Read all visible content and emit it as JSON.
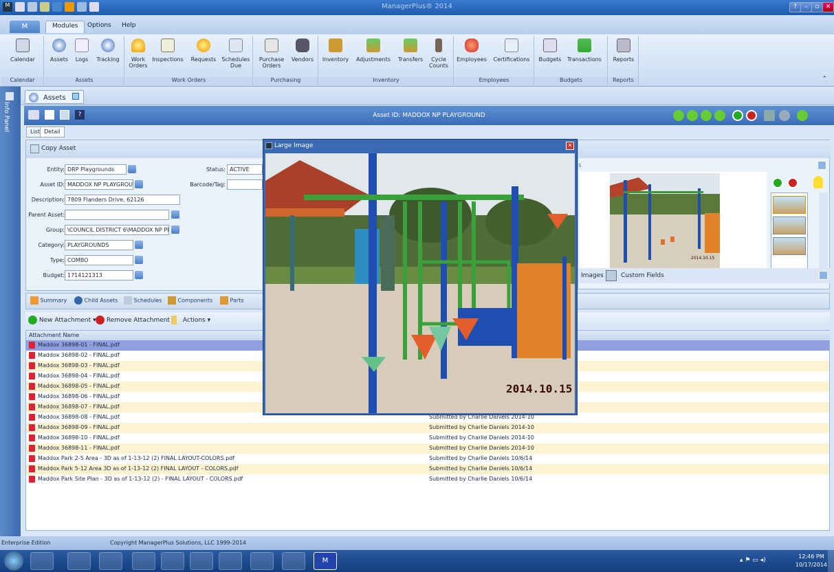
{
  "window": {
    "title": "ManagerPlus® 2014",
    "buttons": [
      "?",
      "–",
      "▫",
      "✕"
    ]
  },
  "menu": {
    "orb": "M",
    "tabs": [
      "Modules",
      "Options",
      "Help"
    ]
  },
  "ribbon": {
    "groups": [
      {
        "caption": "Calendar",
        "buttons": [
          {
            "label": "Calendar",
            "icon": "calendar-icon"
          }
        ]
      },
      {
        "caption": "Assets",
        "buttons": [
          {
            "label": "Assets",
            "icon": "globe-icon"
          },
          {
            "label": "Logs",
            "icon": "log-icon"
          },
          {
            "label": "Tracking",
            "icon": "tracking-icon"
          }
        ]
      },
      {
        "caption": "Work Orders",
        "buttons": [
          {
            "label": "Work\nOrders",
            "icon": "hardhat-icon"
          },
          {
            "label": "Inspections",
            "icon": "clipboard-icon"
          },
          {
            "label": "Requests",
            "icon": "request-icon"
          },
          {
            "label": "Schedules\nDue",
            "icon": "schedule-icon"
          }
        ]
      },
      {
        "caption": "Purchasing",
        "buttons": [
          {
            "label": "Purchase\nOrders",
            "icon": "po-icon"
          },
          {
            "label": "Vendors",
            "icon": "vendor-icon"
          }
        ]
      },
      {
        "caption": "Inventory",
        "buttons": [
          {
            "label": "Inventory",
            "icon": "inventory-icon"
          },
          {
            "label": "Adjustments",
            "icon": "adjust-icon"
          },
          {
            "label": "Transfers",
            "icon": "transfer-icon"
          },
          {
            "label": "Cycle\nCounts",
            "icon": "count-icon"
          }
        ]
      },
      {
        "caption": "Employees",
        "buttons": [
          {
            "label": "Employees",
            "icon": "employees-icon"
          },
          {
            "label": "Certifications",
            "icon": "certificate-icon"
          }
        ]
      },
      {
        "caption": "Budgets",
        "buttons": [
          {
            "label": "Budgets",
            "icon": "scales-icon"
          },
          {
            "label": "Transactions",
            "icon": "ledger-icon"
          }
        ]
      },
      {
        "caption": "Reports",
        "buttons": [
          {
            "label": "Reports",
            "icon": "printer-icon"
          }
        ]
      }
    ]
  },
  "infopanel": {
    "label": "Info Panel"
  },
  "doc": {
    "tab": "Assets",
    "title": "Asset ID: MADDOX NP PLAYGROUND",
    "subtabs": [
      "List",
      "Detail"
    ]
  },
  "form": {
    "copy": "Copy Asset",
    "fields": [
      {
        "label": "Entity:",
        "value": "DRP Playgrounds"
      },
      {
        "label": "Asset ID:",
        "value": "MADDOX NP PLAYGROUND"
      },
      {
        "label": "Description:",
        "value": "7809 Flanders Drive, 62126"
      },
      {
        "label": "Parent Asset:",
        "value": ""
      },
      {
        "label": "Group:",
        "value": "\\COUNCIL DISTRICT 6\\MADDOX NP PLAY"
      },
      {
        "label": "Category:",
        "value": "PLAYGROUNDS"
      },
      {
        "label": "Type:",
        "value": "COMBO"
      },
      {
        "label": "Budget:",
        "value": "1714121313"
      }
    ],
    "status_label": "Status:",
    "status_value": "ACTIVE",
    "barcode_label": "Barcode/Tag:",
    "barcode_value": ""
  },
  "rightpanel": {
    "tab_images": "Images",
    "tab_custom": "Custom Fields",
    "s": "s",
    "thumb_date": "2014.10.15"
  },
  "lowertabs": [
    "Summary",
    "Child Assets",
    "Schedules",
    "Components",
    "Parts"
  ],
  "attachbar": {
    "new": "New Attachment",
    "remove": "Remove Attachment",
    "actions": "Actions"
  },
  "grid": {
    "header": "Attachment Name",
    "rows": [
      {
        "name": "Maddox 36898-01 - FINAL.pdf",
        "desc": ""
      },
      {
        "name": "Maddox 36898-02 - FINAL.pdf",
        "desc": ""
      },
      {
        "name": "Maddox 36898-03 - FINAL.pdf",
        "desc": ""
      },
      {
        "name": "Maddox 36898-04 - FINAL.pdf",
        "desc": ""
      },
      {
        "name": "Maddox 36898-05 - FINAL.pdf",
        "desc": ""
      },
      {
        "name": "Maddox 36898-06 - FINAL.pdf",
        "desc": ""
      },
      {
        "name": "Maddox 36898-07 - FINAL.pdf",
        "desc": ""
      },
      {
        "name": "Maddox 36898-08 - FINAL.pdf",
        "desc": "Submitted by Charlie Daniels 2014-10"
      },
      {
        "name": "Maddox 36898-09 - FINAL.pdf",
        "desc": "Submitted by Charlie Daniels 2014-10"
      },
      {
        "name": "Maddox 36898-10 - FINAL.pdf",
        "desc": "Submitted by Charlie Daniels 2014-10"
      },
      {
        "name": "Maddox 36898-11 - FINAL.pdf",
        "desc": "Submitted by Charlie Daniels 2014-10"
      },
      {
        "name": "Maddox Park 2-5 Area - 3D as of 1-13-12 (2) FINAL LAYOUT-COLORS.pdf",
        "desc": "Submitted by Charlie Daniels 10/6/14"
      },
      {
        "name": "Maddox Park 5-12 Area 3D as of 1-13-12 (2) FINAL LAYOUT - COLORS.pdf",
        "desc": "Submitted by Charlie Daniels 10/6/14"
      },
      {
        "name": "Maddox Park Site Plan - 3D as of 1-13-12 (2) - FINAL LAYOUT - COLORS.pdf",
        "desc": "Submitted by Charlie Daniels 10/6/14"
      }
    ]
  },
  "popup": {
    "title": "Large Image",
    "date_stamp": "2014.10.15"
  },
  "statusbar": {
    "edition": "Enterprise Edition",
    "copyright": "Copyright ManagerPlus Solutions, LLC 1999-2014"
  },
  "taskbar": {
    "time": "12:46 PM",
    "date": "10/17/2014"
  }
}
